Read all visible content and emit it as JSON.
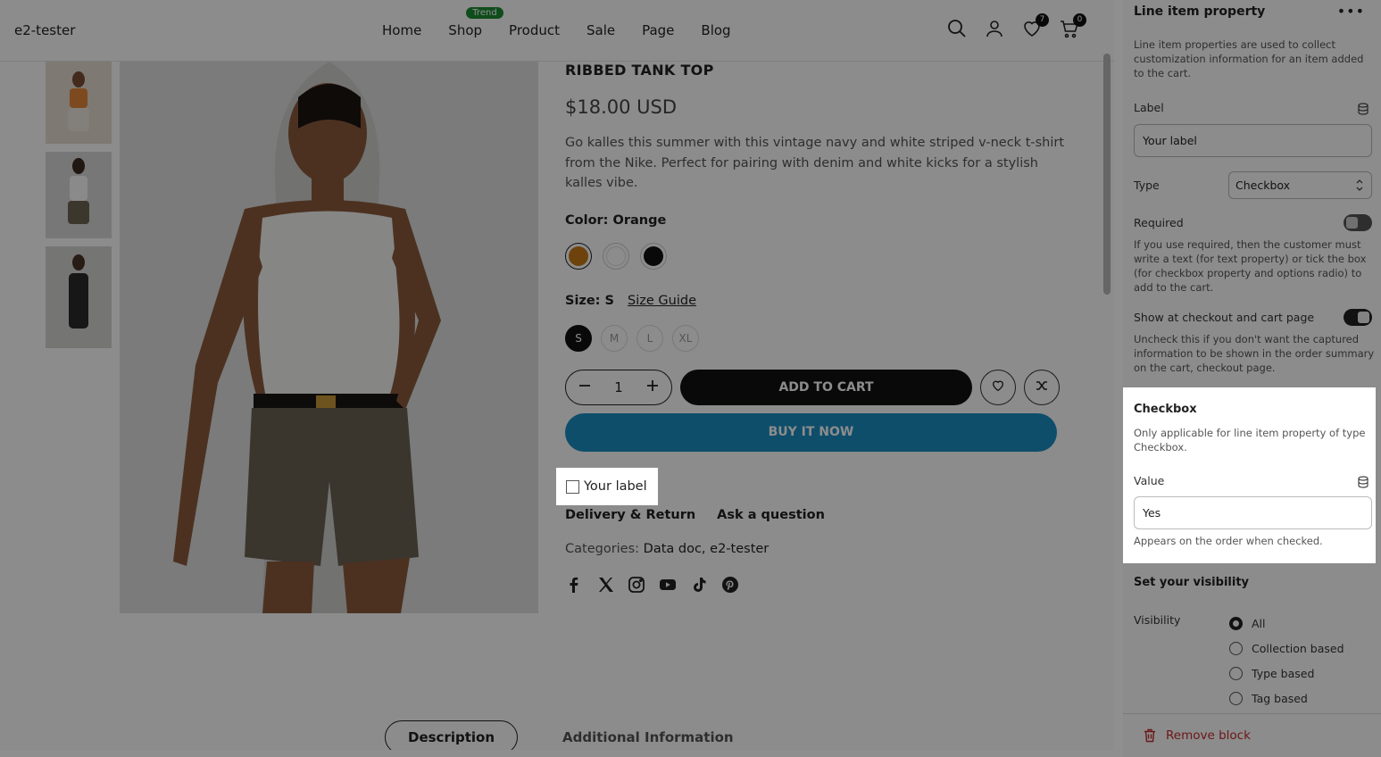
{
  "store": {
    "logo": "e2-tester",
    "nav": [
      {
        "label": "Home"
      },
      {
        "label": "Shop",
        "badge": "Trend"
      },
      {
        "label": "Product"
      },
      {
        "label": "Sale"
      },
      {
        "label": "Page"
      },
      {
        "label": "Blog"
      }
    ],
    "wishlist_count": "7",
    "cart_count": "0",
    "product": {
      "title": "RIBBED TANK TOP",
      "price": "$18.00 USD",
      "description": "Go kalles this summer with this vintage navy and white striped v-neck t-shirt from the Nike. Perfect for pairing with denim and white kicks for a stylish kalles vibe.",
      "color_label": "Color: Orange",
      "swatches": [
        "#c77817",
        "#ffffff",
        "#111111"
      ],
      "size_label": "Size: S",
      "size_guide": "Size Guide",
      "sizes": [
        "S",
        "M",
        "L",
        "XL"
      ],
      "quantity": "1",
      "add_to_cart": "ADD TO CART",
      "buy_now": "BUY IT NOW",
      "custom_label": "Your label",
      "delivery": "Delivery & Return",
      "ask": "Ask a question",
      "categories_prefix": "Categories:",
      "categories": "Data doc, e2-tester"
    },
    "tabs": [
      "Description",
      "Additional Information"
    ]
  },
  "panel": {
    "title": "Line item property",
    "intro": "Line item properties are used to collect customization information for an item added to the cart.",
    "label_field": {
      "label": "Label",
      "value": "Your label"
    },
    "type_field": {
      "label": "Type",
      "value": "Checkbox"
    },
    "required": {
      "label": "Required",
      "help": "If you use required, then the customer must write a text (for text property) or tick the box (for checkbox property and options radio) to add to the cart."
    },
    "show_checkout": {
      "label": "Show at checkout and cart page",
      "help": "Uncheck this if you don't want the captured information to be shown in the order summary on the cart, checkout page."
    },
    "checkbox": {
      "title": "Checkbox",
      "help": "Only applicable for line item property of type Checkbox.",
      "value_label": "Value",
      "value": "Yes",
      "value_help": "Appears on the order when checked."
    },
    "visibility": {
      "title": "Set your visibility",
      "label": "Visibility",
      "options": [
        "All",
        "Collection based",
        "Type based",
        "Tag based"
      ]
    },
    "remove": "Remove block"
  }
}
